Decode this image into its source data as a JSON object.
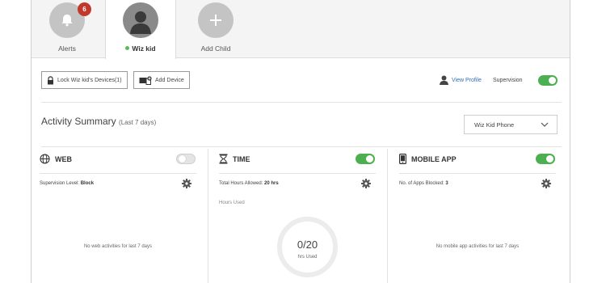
{
  "tabs": [
    {
      "label": "Alerts",
      "badge": "6",
      "icon": "bell-icon"
    },
    {
      "label": "Wiz kid",
      "status_color": "#5cb85c",
      "icon": "avatar"
    },
    {
      "label": "Add Child",
      "icon": "plus-icon"
    }
  ],
  "toolbar": {
    "lock_label": "Lock Wiz kid's Devices(1)",
    "add_device_label": "Add Device",
    "view_profile_label": "View Profile",
    "supervision_label": "Supervision",
    "supervision_on": true
  },
  "summary": {
    "title": "Activity Summary",
    "subtitle": "(Last 7 days)",
    "device_selected": "Wiz Kid Phone"
  },
  "panels": {
    "web": {
      "title": "WEB",
      "icon": "globe-icon",
      "enabled": false,
      "info_label": "Supervision Level:",
      "info_value": "Block",
      "empty_message": "No web activities for last 7 days"
    },
    "time": {
      "title": "TIME",
      "icon": "hourglass-icon",
      "enabled": true,
      "info_label": "Total Hours Allowed:",
      "info_value": "20 hrs",
      "hours_used_label": "Hours Used",
      "ring_value": "0/20",
      "ring_sub": "hrs Used"
    },
    "mobile": {
      "title": "MOBILE APP",
      "icon": "phone-icon",
      "enabled": true,
      "info_label": "No. of Apps Blocked:",
      "info_value": "3",
      "empty_message": "No mobile app activities for last 7 days"
    }
  },
  "colors": {
    "accent_green": "#4caf50",
    "badge_red": "#c0392b",
    "link_blue": "#2c6fb7"
  }
}
